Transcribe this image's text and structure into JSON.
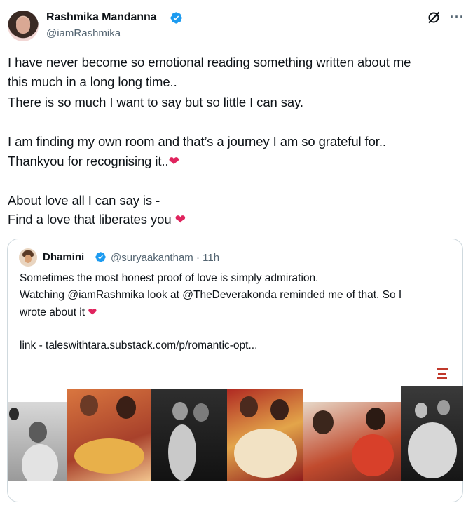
{
  "author": {
    "name": "Rashmika Mandanna",
    "handle": "@iamRashmika",
    "verified_color": "#1d9bf0"
  },
  "header_icons": [
    "grok-icon",
    "more-icon"
  ],
  "tweet": {
    "lines": [
      "I have never become so emotional reading something written about me",
      "this much in a long long time..",
      "There is so much I want to say but so little I can say.",
      "I am finding my own room and that’s a journey I am so grateful for..",
      "Thankyou for recognising it..",
      "About love all I can say is -",
      "Find a love that liberates you"
    ],
    "heart": "❤"
  },
  "quoted": {
    "name": "Dhamini",
    "handle": "@suryaakantham",
    "separator": "·",
    "time": "11h",
    "lines": [
      "Sometimes the most honest proof of love is simply admiration.",
      "Watching @iamRashmika look at @TheDeverakonda reminded me of that. So I",
      "wrote about it",
      "link - taleswithtara.substack.com/p/romantic-opt..."
    ],
    "heart": "❤",
    "media_logo": "tales with tara"
  },
  "colors": {
    "text": "#0f1419",
    "muted": "#536471",
    "border": "#cfd9de",
    "heart": "#e0245e"
  }
}
